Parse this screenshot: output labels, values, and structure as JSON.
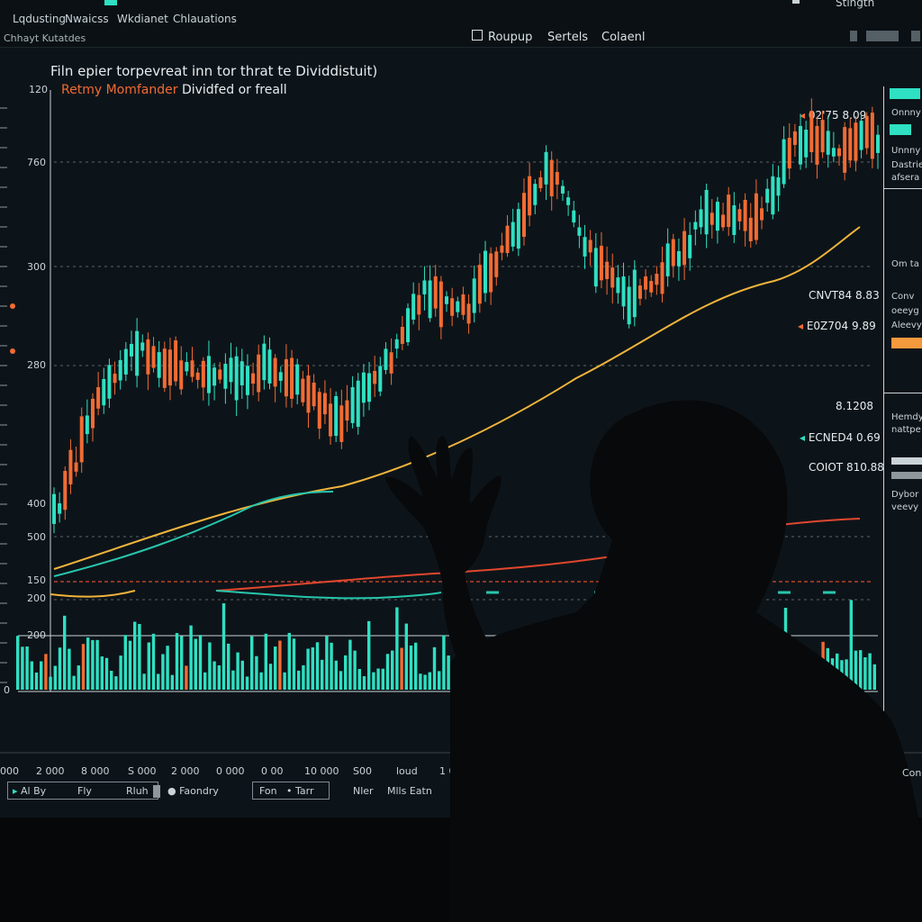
{
  "menu": {
    "items": [
      "Lqdusting",
      "Nwaicss",
      "Wkdianet",
      "Chlauations"
    ],
    "right_text": "Stingth"
  },
  "subtitle": "Chhayt Kutatdes",
  "toolbar": {
    "buttons": [
      "Roupup",
      "Sertels",
      "Colaenl"
    ]
  },
  "chart": {
    "title": "Filn epier torpevreat inn tor thrat te Dividdistuit)",
    "legend_a": "Retmy Momfander",
    "legend_b": "Dividfed or freall",
    "y_labels": [
      "120",
      "760",
      "300",
      "280",
      "400",
      "500",
      "150",
      "200",
      "200",
      "0"
    ],
    "x_labels": [
      "2 000",
      "8 000",
      "S 000",
      "2 000",
      "0 000",
      "0 00",
      "10 000",
      "S00",
      "loud",
      "1 000"
    ],
    "price_labels": [
      "02'75 8.09",
      "CNVT84 8.83",
      "E0Z704 9.89",
      "8.1208",
      "ECNED4 0.69",
      "COIOT 810.88"
    ],
    "colors": {
      "bull": "#2fe0c2",
      "bear": "#f26b33",
      "ma_yellow": "#f0b43c",
      "ma_teal": "#27c6ad",
      "ma_red": "#e0472e",
      "grid": "#5b646a"
    }
  },
  "side_panel": {
    "items": [
      "Onnny",
      "Unnny",
      "Dastries",
      "afsera",
      "Om ta",
      "Conv",
      "oeeyg",
      "Aleevy",
      "Hemdy",
      "nattpe",
      "Dybor",
      "veevy"
    ]
  },
  "bottom_bar": {
    "items": [
      "Al By",
      "Fly",
      "Rluh",
      "Faondry",
      "Fon",
      "Tarr",
      "Nler",
      "Mlls Eatn"
    ]
  },
  "bottom_right": "Con",
  "chart_data": {
    "type": "candlestick",
    "title": "Filn epier torpevreat inn tor thrat te Dividdistuit)",
    "series": [
      {
        "name": "Retmy Momfander",
        "style": "candlestick"
      },
      {
        "name": "Dividfed or freall",
        "style": "line"
      }
    ],
    "y_tick_labels": [
      "120",
      "760",
      "300",
      "280",
      "400",
      "500",
      "150",
      "200",
      "200",
      "0"
    ],
    "x_tick_labels": [
      "2 000",
      "8 000",
      "S 000",
      "2 000",
      "0 000",
      "0 00",
      "10 000",
      "S00",
      "loud",
      "1 000"
    ],
    "trend": [
      [
        0.0,
        0.1
      ],
      [
        0.05,
        0.35
      ],
      [
        0.1,
        0.5
      ],
      [
        0.15,
        0.45
      ],
      [
        0.2,
        0.42
      ],
      [
        0.25,
        0.45
      ],
      [
        0.3,
        0.4
      ],
      [
        0.35,
        0.32
      ],
      [
        0.4,
        0.45
      ],
      [
        0.45,
        0.62
      ],
      [
        0.5,
        0.58
      ],
      [
        0.55,
        0.75
      ],
      [
        0.6,
        0.92
      ],
      [
        0.63,
        0.8
      ],
      [
        0.66,
        0.7
      ],
      [
        0.7,
        0.6
      ],
      [
        0.75,
        0.7
      ],
      [
        0.8,
        0.82
      ],
      [
        0.85,
        0.78
      ],
      [
        0.9,
        0.98
      ],
      [
        0.92,
        1.0
      ],
      [
        0.95,
        0.97
      ],
      [
        1.0,
        1.0
      ]
    ]
  }
}
